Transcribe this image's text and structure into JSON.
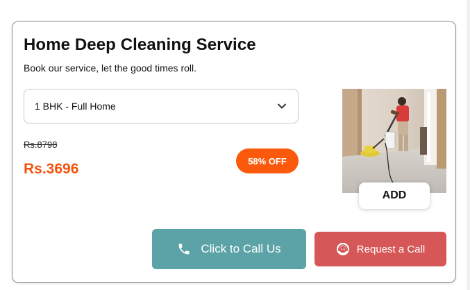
{
  "card": {
    "title": "Home Deep Cleaning Service",
    "subtitle": "Book our service, let the good times roll."
  },
  "package_select": {
    "selected": "1 BHK - Full Home",
    "icon": "chevron-down-icon"
  },
  "pricing": {
    "original_price": "Rs.8798",
    "discounted_price": "Rs.3696",
    "discount_badge": "58% OFF"
  },
  "image": {
    "add_label": "ADD"
  },
  "actions": {
    "call_label": "Click to Call Us",
    "call_icon": "phone-icon",
    "request_label": "Request a Call",
    "request_icon": "headset-agent-icon"
  },
  "colors": {
    "price_accent": "#f2540f",
    "badge": "#fb5a0c",
    "call_button": "#5ca3a8",
    "request_button": "#d65757"
  }
}
